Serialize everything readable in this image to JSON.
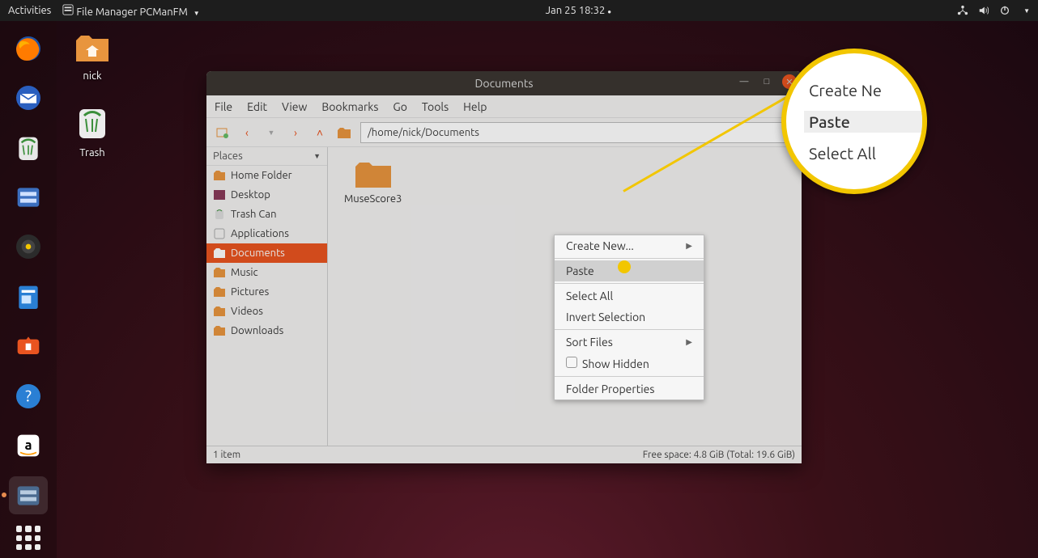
{
  "topbar": {
    "activities": "Activities",
    "app_title": "File Manager PCManFM",
    "datetime": "Jan 25  18:32"
  },
  "desktop": {
    "home_label": "nick",
    "trash_label": "Trash"
  },
  "fm": {
    "title": "Documents",
    "menu": [
      "File",
      "Edit",
      "View",
      "Bookmarks",
      "Go",
      "Tools",
      "Help"
    ],
    "path": "/home/nick/Documents",
    "places_header": "Places",
    "places": [
      "Home Folder",
      "Desktop",
      "Trash Can",
      "Applications",
      "Documents",
      "Music",
      "Pictures",
      "Videos",
      "Downloads"
    ],
    "selected_place_index": 4,
    "file_label": "MuseScore3",
    "status_left": "1 item",
    "status_right": "Free space: 4.8 GiB (Total: 19.6 GiB)"
  },
  "context_menu": {
    "create_new": "Create New...",
    "paste": "Paste",
    "select_all": "Select All",
    "invert_selection": "Invert Selection",
    "sort_files": "Sort Files",
    "show_hidden": "Show Hidden",
    "folder_properties": "Folder Properties"
  },
  "callout": {
    "line1": "Create Ne",
    "line2": "Paste",
    "line3": "Select All"
  }
}
